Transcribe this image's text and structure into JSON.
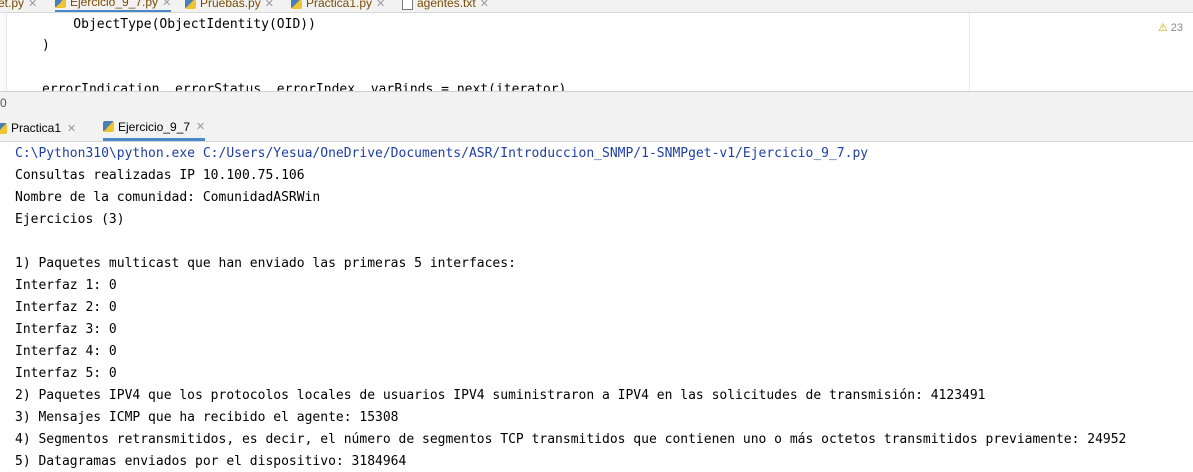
{
  "editor_tabs": [
    {
      "label": "et.py",
      "type": "py",
      "active": false
    },
    {
      "label": "Ejercicio_9_7.py",
      "type": "py",
      "active": true
    },
    {
      "label": "Pruebas.py",
      "type": "py",
      "active": false
    },
    {
      "label": "Practica1.py",
      "type": "py",
      "active": false
    },
    {
      "label": "agentes.txt",
      "type": "txt",
      "active": false
    }
  ],
  "editor": {
    "lines": [
      "    ObjectType(ObjectIdentity(OID))",
      ")",
      "",
      "errorIndication, errorStatus, errorIndex, varBinds = next(iterator)"
    ],
    "warning_count": "23"
  },
  "splitter_number": "0",
  "run_tabs": [
    {
      "label": "Practica1",
      "active": false
    },
    {
      "label": "Ejercicio_9_7",
      "active": true
    }
  ],
  "console": {
    "command": "C:\\Python310\\python.exe C:/Users/Yesua/OneDrive/Documents/ASR/Introduccion_SNMP/1-SNMPget-v1/Ejercicio_9_7.py",
    "lines": [
      "Consultas realizadas IP 10.100.75.106",
      "Nombre de la comunidad: ComunidadASRWin",
      "Ejercicios (3)",
      "",
      "1) Paquetes multicast que han enviado las primeras 5 interfaces:",
      "Interfaz 1: 0",
      "Interfaz 2: 0",
      "Interfaz 3: 0",
      "Interfaz 4: 0",
      "Interfaz 5: 0",
      "2) Paquetes IPV4 que los protocolos locales de usuarios IPV4 suministraron a IPV4 en las solicitudes de transmisión: 4123491",
      "3) Mensajes ICMP que ha recibido el agente: 15308",
      "4) Segmentos retransmitidos, es decir, el número de segmentos TCP transmitidos que contienen uno o más octetos transmitidos previamente: 24952",
      "5) Datagramas enviados por el dispositivo: 3184964"
    ]
  }
}
